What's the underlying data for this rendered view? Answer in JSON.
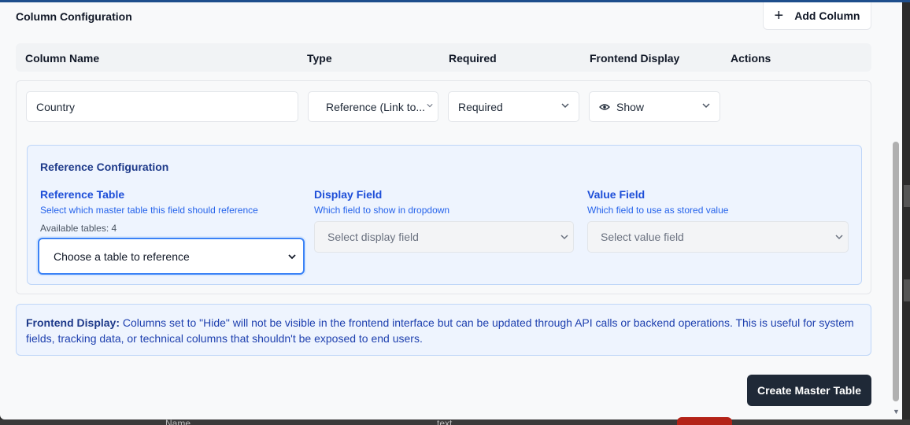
{
  "section": {
    "title": "Column Configuration",
    "add_button": "Add Column"
  },
  "headers": {
    "column_name": "Column Name",
    "type": "Type",
    "required": "Required",
    "frontend_display": "Frontend Display",
    "actions": "Actions"
  },
  "row": {
    "column_name_value": "Country",
    "type_value": "Reference (Link to...",
    "required_value": "Required",
    "display_value": "Show"
  },
  "reference": {
    "title": "Reference Configuration",
    "table_label": "Reference Table",
    "table_hint": "Select which master table this field should reference",
    "available": "Available tables: 4",
    "table_placeholder": "Choose a table to reference",
    "display_label": "Display Field",
    "display_hint": "Which field to show in dropdown",
    "display_placeholder": "Select display field",
    "value_label": "Value Field",
    "value_hint": "Which field to use as stored value",
    "value_placeholder": "Select value field"
  },
  "info": {
    "bold": "Frontend Display:",
    "text": "Columns set to \"Hide\" will not be visible in the frontend interface but can be updated through API calls or backend operations. This is useful for system fields, tracking data, or technical columns that shouldn't be exposed to end users."
  },
  "footer": {
    "create_button": "Create Master Table"
  },
  "background": {
    "ghost_left": "Name",
    "ghost_right": "text"
  },
  "colors": {
    "accent": "#3b82f6",
    "primary_button": "#1f2937",
    "info_bg": "#eef4fe"
  }
}
